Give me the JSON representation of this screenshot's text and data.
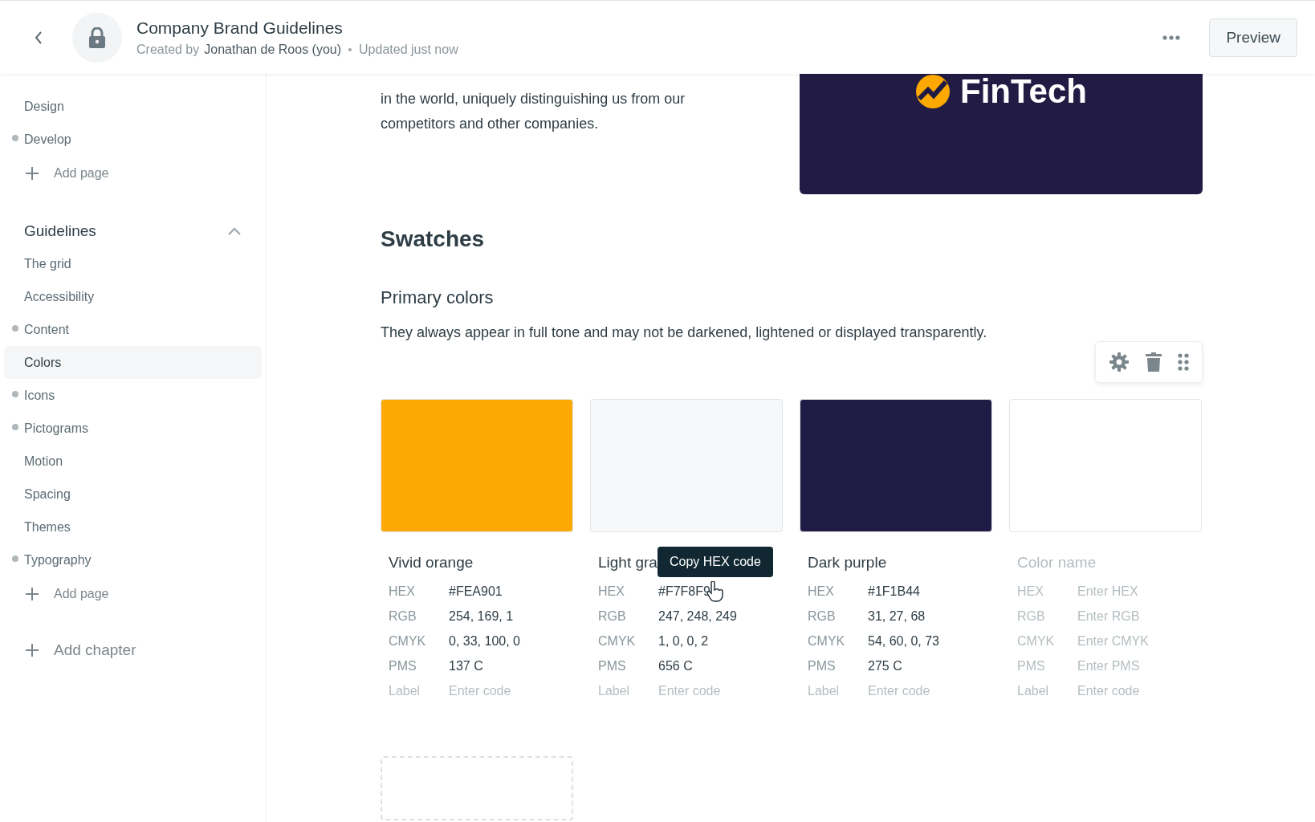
{
  "header": {
    "title": "Company Brand Guidelines",
    "created_prefix": "Created by",
    "author": "Jonathan de Roos (you)",
    "updated": "Updated just now",
    "preview_button": "Preview"
  },
  "sidebar": {
    "top_items": [
      {
        "label": "Design",
        "marked": false
      },
      {
        "label": "Develop",
        "marked": true
      }
    ],
    "top_add_page": "Add page",
    "chapter": {
      "title": "Guidelines",
      "expanded": true,
      "items": [
        {
          "label": "The grid",
          "marked": false,
          "selected": false
        },
        {
          "label": "Accessibility",
          "marked": false,
          "selected": false
        },
        {
          "label": "Content",
          "marked": true,
          "selected": false
        },
        {
          "label": "Colors",
          "marked": false,
          "selected": true
        },
        {
          "label": "Icons",
          "marked": true,
          "selected": false
        },
        {
          "label": "Pictograms",
          "marked": true,
          "selected": false
        },
        {
          "label": "Motion",
          "marked": false,
          "selected": false
        },
        {
          "label": "Spacing",
          "marked": false,
          "selected": false
        },
        {
          "label": "Themes",
          "marked": false,
          "selected": false
        },
        {
          "label": "Typography",
          "marked": true,
          "selected": false
        }
      ],
      "add_page": "Add page"
    },
    "add_chapter": "Add chapter"
  },
  "content": {
    "intro_text": "in the world, uniquely distinguishing us from our competitors and other companies.",
    "logo_text": "FinTech",
    "heading": "Swatches",
    "subheading": "Primary colors",
    "description": "They always appear in full tone and may not be darkened, lightened or displayed transparently.",
    "swatches": [
      {
        "name": "Vivid orange",
        "color": "#fea901",
        "fields": [
          {
            "label": "HEX",
            "value": "#FEA901"
          },
          {
            "label": "RGB",
            "value": "254, 169, 1"
          },
          {
            "label": "CMYK",
            "value": "0, 33, 100, 0"
          },
          {
            "label": "PMS",
            "value": "137 C"
          },
          {
            "label": "Label",
            "placeholder": "Enter code"
          }
        ]
      },
      {
        "name": "Light gra",
        "color": "#f7f8f9",
        "tooltip": "Copy HEX code",
        "fields": [
          {
            "label": "HEX",
            "value": "#F7F8F9"
          },
          {
            "label": "RGB",
            "value": "247, 248, 249"
          },
          {
            "label": "CMYK",
            "value": "1, 0, 0, 2"
          },
          {
            "label": "PMS",
            "value": "656 C"
          },
          {
            "label": "Label",
            "placeholder": "Enter code"
          }
        ]
      },
      {
        "name": "Dark purple",
        "color": "#1f1b44",
        "fields": [
          {
            "label": "HEX",
            "value": "#1F1B44"
          },
          {
            "label": "RGB",
            "value": "31, 27, 68"
          },
          {
            "label": "CMYK",
            "value": "54, 60, 0, 73"
          },
          {
            "label": "PMS",
            "value": "275 C"
          },
          {
            "label": "Label",
            "placeholder": "Enter code"
          }
        ]
      },
      {
        "name_placeholder": "Color name",
        "color": "#ffffff",
        "fields": [
          {
            "label": "HEX",
            "placeholder": "Enter HEX"
          },
          {
            "label": "RGB",
            "placeholder": "Enter RGB"
          },
          {
            "label": "CMYK",
            "placeholder": "Enter CMYK"
          },
          {
            "label": "PMS",
            "placeholder": "Enter PMS"
          },
          {
            "label": "Label",
            "placeholder": "Enter code"
          }
        ]
      }
    ]
  }
}
